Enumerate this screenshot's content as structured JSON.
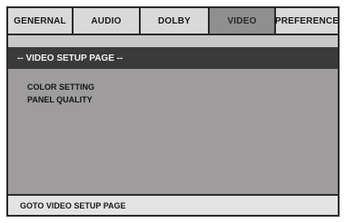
{
  "tabs": [
    {
      "label": "GENERNAL",
      "active": false
    },
    {
      "label": "AUDIO",
      "active": false
    },
    {
      "label": "DOLBY",
      "active": false
    },
    {
      "label": "VIDEO",
      "active": true
    },
    {
      "label": "PREFERENCE",
      "active": false
    }
  ],
  "header": {
    "title": "-- VIDEO SETUP PAGE --"
  },
  "menu": {
    "items": [
      "COLOR SETTING",
      "PANEL QUALITY"
    ]
  },
  "footer": {
    "status": "GOTO VIDEO SETUP PAGE"
  },
  "colors": {
    "panel": "#9e9c9d",
    "header": "#3a3a3a",
    "active_tab": "#8f8f8f"
  }
}
